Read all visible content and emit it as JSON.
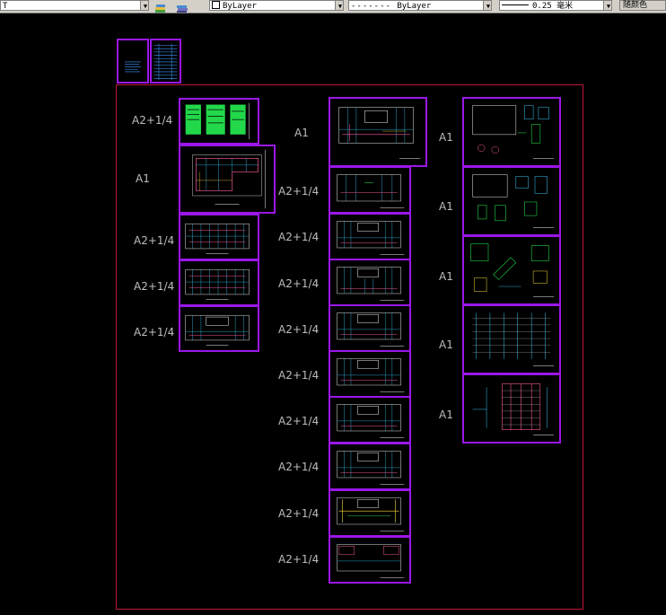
{
  "toolbar": {
    "layer_value": "T",
    "color_value": "ByLayer",
    "linetype_value": "ByLayer",
    "lineweight_value": "0.25 毫米",
    "plotstyle_button": "随颜色"
  },
  "column1_labels": [
    "A2+1/4",
    "A1",
    "A2+1/4",
    "A2+1/4",
    "A2+1/4"
  ],
  "column2_labels": [
    "A1",
    "A2+1/4",
    "A2+1/4",
    "A2+1/4",
    "A2+1/4",
    "A2+1/4",
    "A2+1/4",
    "A2+1/4",
    "A2+1/4",
    "A2+1/4"
  ],
  "column3_labels": [
    "A1",
    "A1",
    "A1",
    "A1",
    "A1"
  ],
  "colors": {
    "frame": "#c0183a",
    "sheet_border": "#9b17e8",
    "label": "#bdbdbd"
  }
}
